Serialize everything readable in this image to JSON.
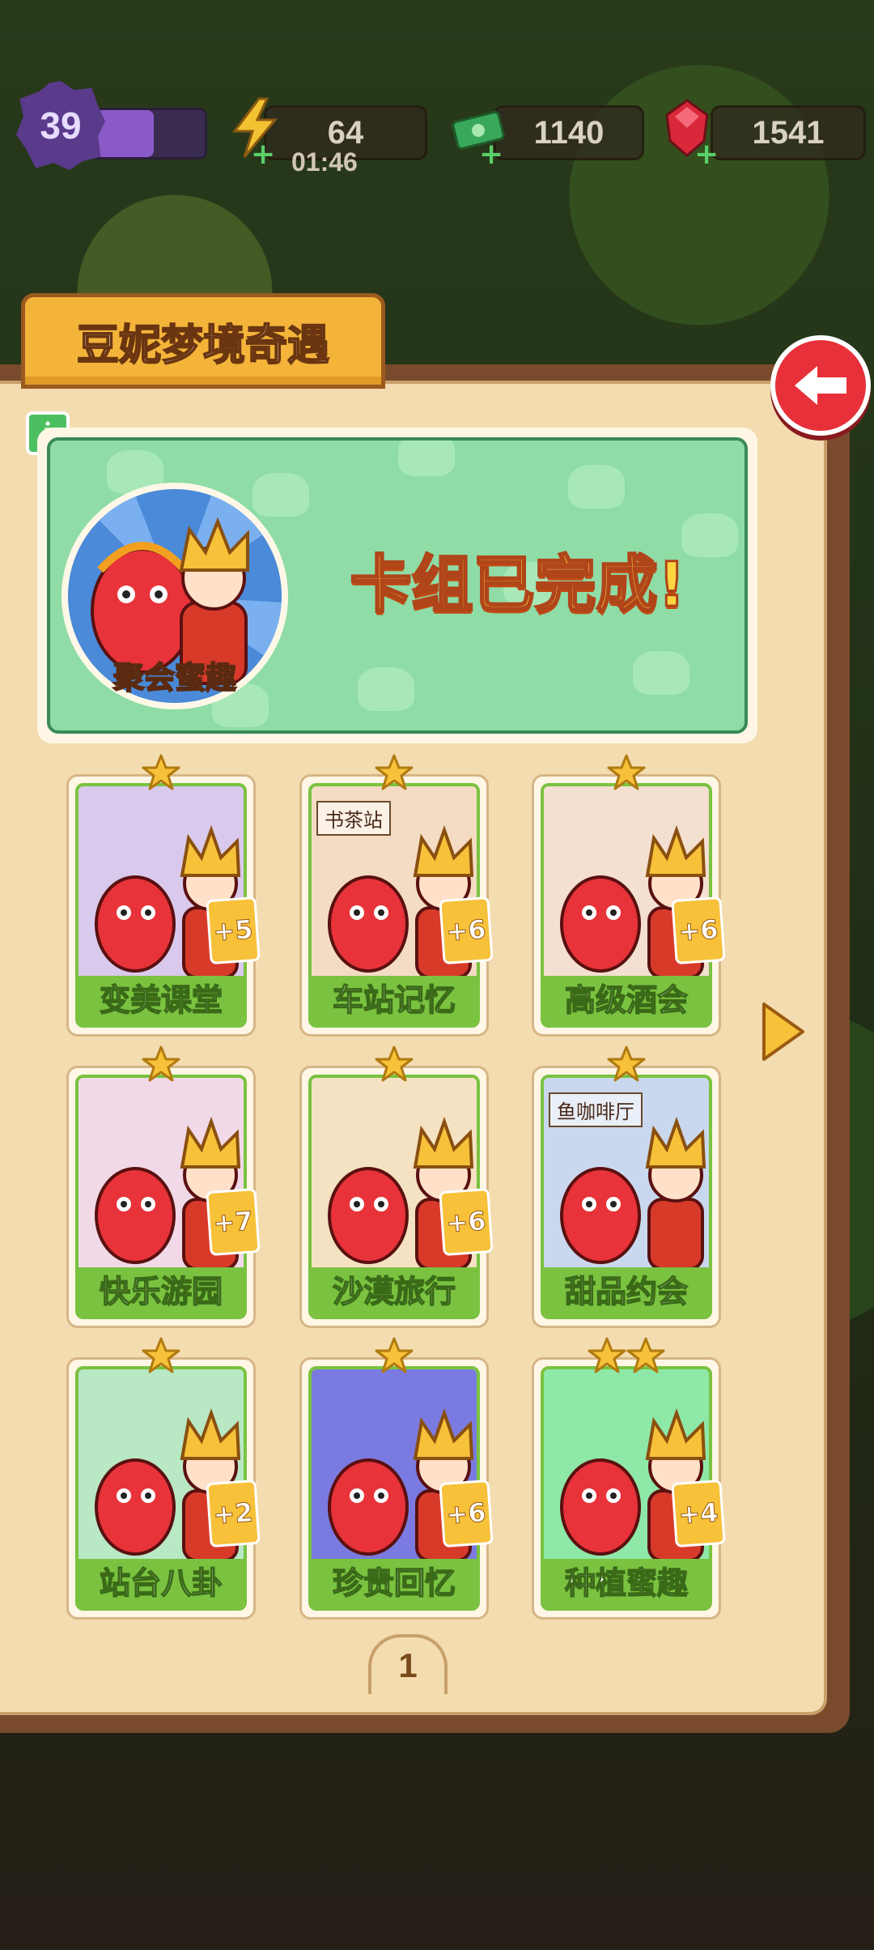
{
  "hud": {
    "level": "39",
    "xp_fraction": 0.55,
    "energy": "64",
    "energy_timer": "01:46",
    "cash": "1140",
    "gems": "1541",
    "plus_symbol": "+"
  },
  "panel": {
    "title": "豆妮梦境奇遇",
    "info_symbol": "i",
    "banner": {
      "avatar_label": "聚会蜜趣",
      "status_text": "卡组已完成!"
    },
    "page_number": "1"
  },
  "cards": [
    {
      "label": "变美课堂",
      "count": "+5",
      "stars": 1,
      "art_color": "#d9c9ec"
    },
    {
      "label": "车站记忆",
      "count": "+6",
      "stars": 1,
      "art_color": "#f4dcc4",
      "sign": "书茶站"
    },
    {
      "label": "高级酒会",
      "count": "+6",
      "stars": 1,
      "art_color": "#f3e0d0"
    },
    {
      "label": "快乐游园",
      "count": "+7",
      "stars": 1,
      "art_color": "#f1d9e8"
    },
    {
      "label": "沙漠旅行",
      "count": "+6",
      "stars": 1,
      "art_color": "#f4e2c2"
    },
    {
      "label": "甜品约会",
      "count": "",
      "stars": 1,
      "art_color": "#c9d8ee",
      "sign": "鱼咖啡厅"
    },
    {
      "label": "站台八卦",
      "count": "+2",
      "stars": 1,
      "art_color": "#b8e8c4"
    },
    {
      "label": "珍贵回忆",
      "count": "+6",
      "stars": 1,
      "art_color": "#7a7ae0"
    },
    {
      "label": "种植蜜趣",
      "count": "+4",
      "stars": 2,
      "art_color": "#8ee8a8"
    }
  ],
  "colors": {
    "accent_green": "#7ac240",
    "panel_brown": "#7a4a2c",
    "tab_orange": "#f4b43a",
    "back_red": "#e8303a"
  }
}
